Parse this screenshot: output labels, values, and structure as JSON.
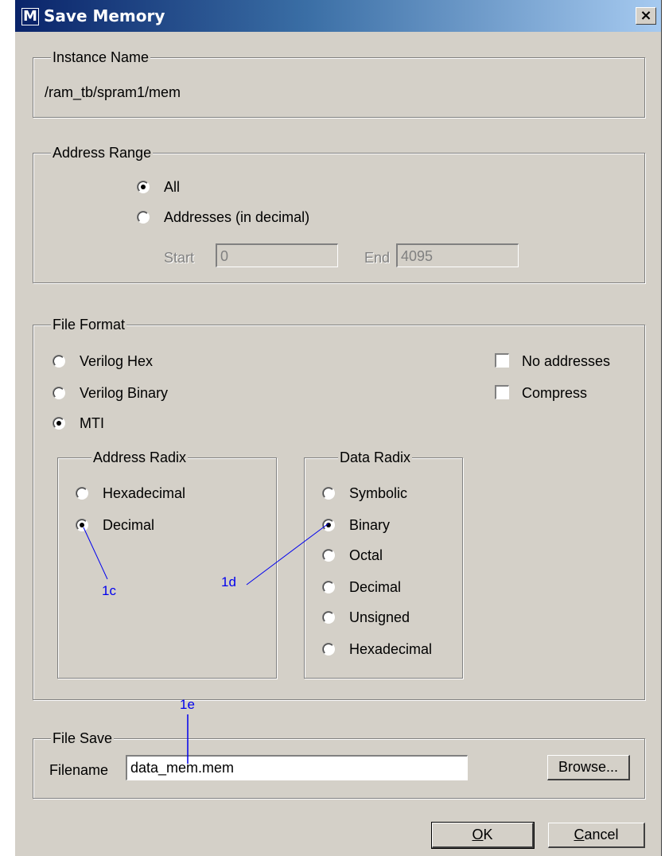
{
  "window": {
    "title": "Save Memory",
    "icon": "modelsim-m-icon",
    "close_label": "×"
  },
  "instance_name": {
    "legend": "Instance Name",
    "value": "/ram_tb/spram1/mem"
  },
  "address_range": {
    "legend": "Address Range",
    "options": [
      {
        "label": "All",
        "checked": true
      },
      {
        "label": "Addresses (in decimal)",
        "checked": false
      }
    ],
    "start_label": "Start",
    "start_value": "0",
    "end_label": "End",
    "end_value": "4095"
  },
  "file_format": {
    "legend": "File Format",
    "options": [
      {
        "label": "Verilog Hex",
        "checked": false
      },
      {
        "label": "Verilog Binary",
        "checked": false
      },
      {
        "label": "MTI",
        "checked": true
      }
    ],
    "checkboxes": [
      {
        "label": "No addresses",
        "checked": false
      },
      {
        "label": "Compress",
        "checked": false
      }
    ],
    "address_radix": {
      "legend": "Address Radix",
      "options": [
        {
          "label": "Hexadecimal",
          "checked": false
        },
        {
          "label": "Decimal",
          "checked": true
        }
      ]
    },
    "data_radix": {
      "legend": "Data Radix",
      "options": [
        {
          "label": "Symbolic",
          "checked": false
        },
        {
          "label": "Binary",
          "checked": true
        },
        {
          "label": "Octal",
          "checked": false
        },
        {
          "label": "Decimal",
          "checked": false
        },
        {
          "label": "Unsigned",
          "checked": false
        },
        {
          "label": "Hexadecimal",
          "checked": false
        }
      ]
    }
  },
  "file_save": {
    "legend": "File Save",
    "filename_label": "Filename",
    "filename_value": "data_mem.mem",
    "browse_label": "Browse..."
  },
  "buttons": {
    "ok_label": "OK",
    "cancel_label": "Cancel"
  },
  "annotations": {
    "c": "1c",
    "d": "1d",
    "e": "1e"
  },
  "colors": {
    "face": "#d4d0c8",
    "title_start": "#0a246a",
    "title_end": "#a6caf0",
    "annotation": "#0000ee"
  }
}
